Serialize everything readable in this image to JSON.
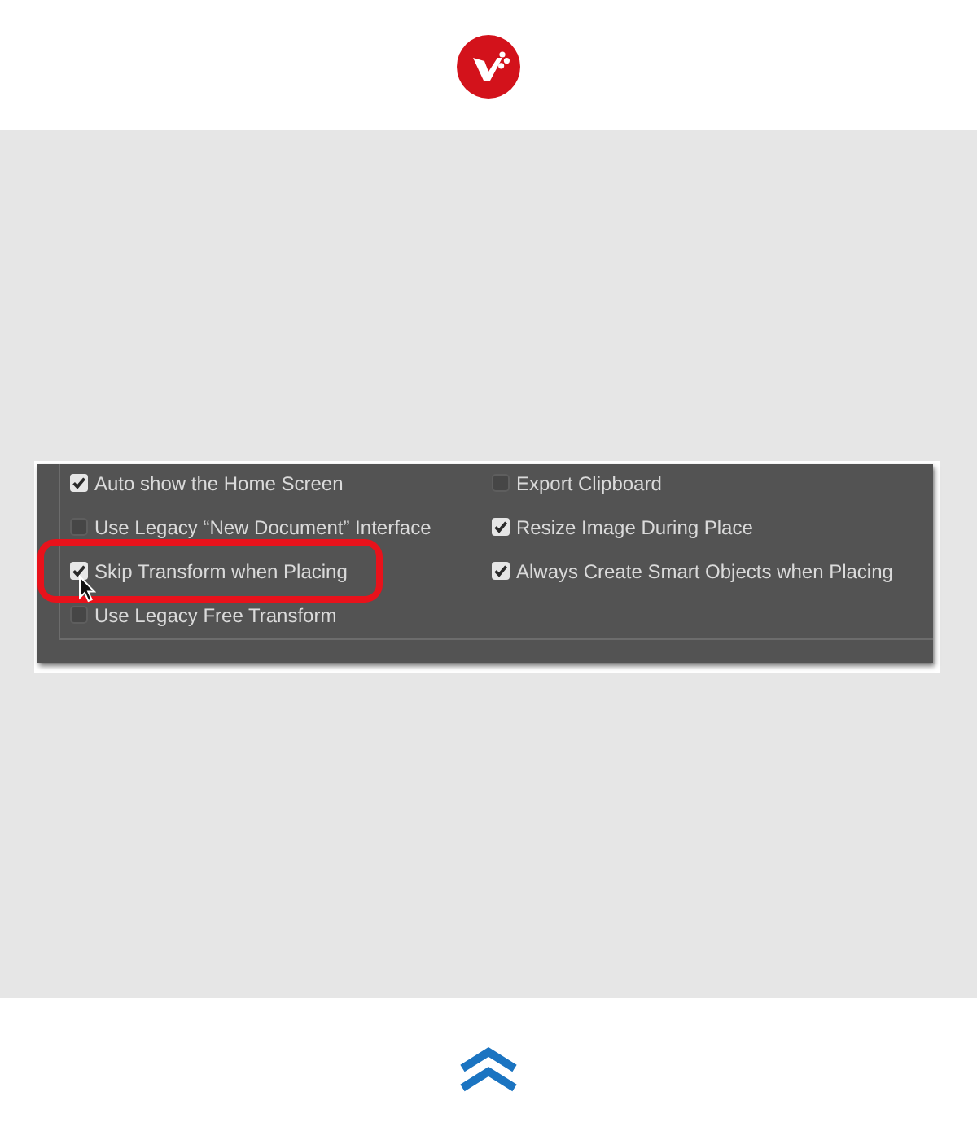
{
  "preferences": {
    "columns": [
      {
        "options": [
          {
            "label": "Auto show the Home Screen",
            "checked": true,
            "highlighted": false,
            "hovered": false
          },
          {
            "label": "Use Legacy “New Document” Interface",
            "checked": false,
            "highlighted": false,
            "hovered": false
          },
          {
            "label": "Skip Transform when Placing",
            "checked": true,
            "highlighted": true,
            "hovered": true
          },
          {
            "label": "Use Legacy Free Transform",
            "checked": false,
            "highlighted": false,
            "hovered": false
          }
        ]
      },
      {
        "options": [
          {
            "label": "Export Clipboard",
            "checked": false,
            "highlighted": false,
            "hovered": false
          },
          {
            "label": "Resize Image During Place",
            "checked": true,
            "highlighted": false,
            "hovered": false
          },
          {
            "label": "Always Create Smart Objects when Placing",
            "checked": true,
            "highlighted": false,
            "hovered": false
          }
        ]
      }
    ]
  }
}
